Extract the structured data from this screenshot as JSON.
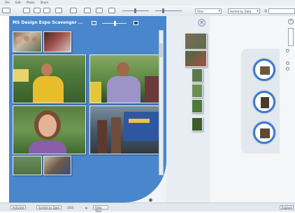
{
  "menu": [
    "File",
    "Edit",
    "Photo",
    "Share"
  ],
  "panel": {
    "title": "MS Design Expo Scavenger ..."
  },
  "toolbar": {
    "filter_label": "Filter",
    "sort_label": "Sorted by Date"
  },
  "statusbar": {
    "left_button": "Activate",
    "dropdown": "Sorted by Date",
    "count": "1/50",
    "view": "View Tiles",
    "right_button": "Explore"
  },
  "colors": {
    "panel": "#4a86cc",
    "accent": "#3b7bd0",
    "chrome": "#dfe6ee"
  }
}
